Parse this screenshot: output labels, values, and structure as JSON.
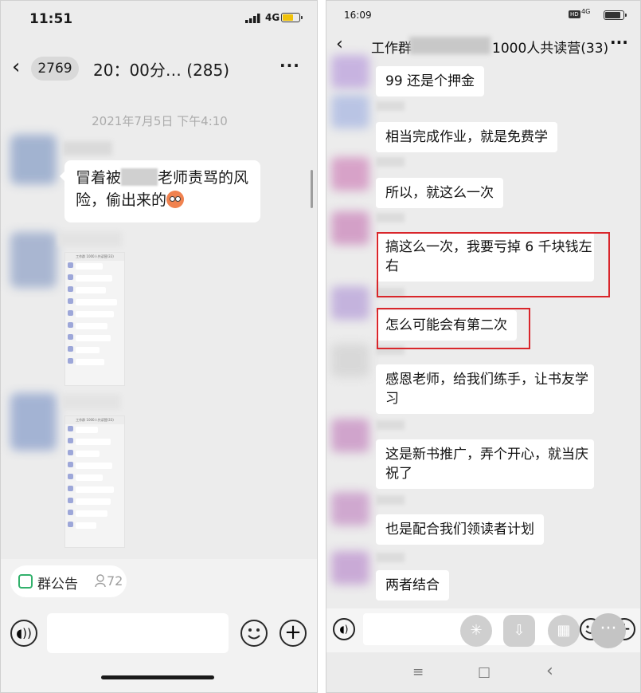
{
  "left": {
    "status_bar": {
      "time": "11:51",
      "network": "4G"
    },
    "nav": {
      "back_icon": "chevron-left",
      "unread_count": "2769",
      "title": "20：00分…",
      "member_count": "(285)",
      "more_icon": "more-horizontal"
    },
    "timestamp": "2021年7月5日 下午4:10",
    "messages": [
      {
        "text_before": "冒着被",
        "text_after": "老师责骂的风险，偷出来的",
        "emoji": "sweat-face-emoji"
      }
    ],
    "thumbnail_header": "工作群 1000人共读营(33)",
    "bottom": {
      "announcement_label": "群公告",
      "announcement_count": "72",
      "voice_icon": "voice-icon",
      "emoji_icon": "smile-icon",
      "plus_icon": "plus-icon"
    }
  },
  "right": {
    "status_bar": {
      "time": "16:09",
      "hd": "HD",
      "network": "4G"
    },
    "nav": {
      "back_icon": "chevron-left",
      "title_prefix": "工作群",
      "title_suffix": "1000人共读营(33)",
      "more_icon": "more-horizontal"
    },
    "messages": [
      {
        "text": "99 还是个押金"
      },
      {
        "text": "相当完成作业，就是免费学"
      },
      {
        "text": "所以，就这么一次"
      },
      {
        "line1": "搞这么一次，我要亏掉 6 千块钱左",
        "line2": "右"
      },
      {
        "text": "怎么可能会有第二次"
      },
      {
        "line1": "感恩老师，给我们练手，让书友学",
        "line2": "习"
      },
      {
        "line1": "这是新书推广，弄个开心，就当庆",
        "line2": "祝了"
      },
      {
        "text": "也是配合我们领读者计划"
      },
      {
        "text": "两者结合"
      }
    ],
    "bottom": {
      "voice_icon": "voice-icon",
      "float_icons": [
        "pinwheel-icon",
        "download-icon",
        "grid-icon",
        "more-icon"
      ],
      "emoji_icon": "smile-icon",
      "plus_icon": "plus-icon",
      "sys_nav": {
        "menu": "≡",
        "home": "□",
        "back": "‹"
      }
    }
  },
  "colors": {
    "highlight_red": "#d9262b",
    "chat_bg": "#ececec",
    "bubble": "#ffffff",
    "announce_green": "#2aae67"
  }
}
